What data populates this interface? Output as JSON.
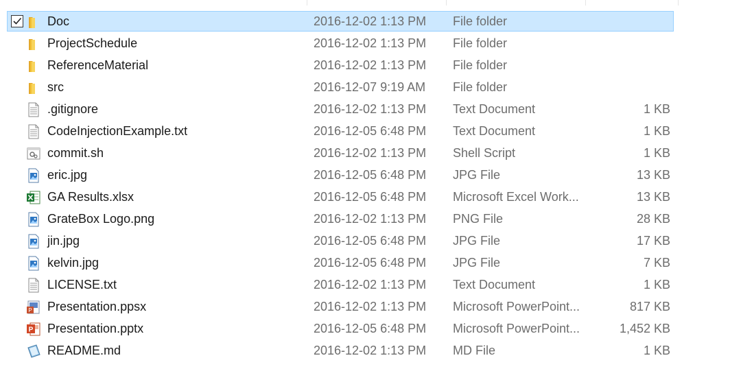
{
  "colors": {
    "selection_bg": "#cce8ff",
    "selection_border": "#99d1ff",
    "folder": "#f6c94e",
    "secondary_text": "#6d6d6d"
  },
  "files": [
    {
      "name": "Doc",
      "date": "2016-12-02 1:13 PM",
      "type": "File folder",
      "size": "",
      "icon": "folder-icon",
      "selected": true
    },
    {
      "name": "ProjectSchedule",
      "date": "2016-12-02 1:13 PM",
      "type": "File folder",
      "size": "",
      "icon": "folder-icon"
    },
    {
      "name": "ReferenceMaterial",
      "date": "2016-12-02 1:13 PM",
      "type": "File folder",
      "size": "",
      "icon": "folder-icon"
    },
    {
      "name": "src",
      "date": "2016-12-07 9:19 AM",
      "type": "File folder",
      "size": "",
      "icon": "folder-icon"
    },
    {
      "name": ".gitignore",
      "date": "2016-12-02 1:13 PM",
      "type": "Text Document",
      "size": "1 KB",
      "icon": "text-file-icon"
    },
    {
      "name": "CodeInjectionExample.txt",
      "date": "2016-12-05 6:48 PM",
      "type": "Text Document",
      "size": "1 KB",
      "icon": "text-file-icon"
    },
    {
      "name": "commit.sh",
      "date": "2016-12-02 1:13 PM",
      "type": "Shell Script",
      "size": "1 KB",
      "icon": "shell-script-icon"
    },
    {
      "name": "eric.jpg",
      "date": "2016-12-05 6:48 PM",
      "type": "JPG File",
      "size": "13 KB",
      "icon": "image-file-icon"
    },
    {
      "name": "GA Results.xlsx",
      "date": "2016-12-05 6:48 PM",
      "type": "Microsoft Excel Work...",
      "size": "13 KB",
      "icon": "excel-file-icon"
    },
    {
      "name": "GrateBox Logo.png",
      "date": "2016-12-02 1:13 PM",
      "type": "PNG File",
      "size": "28 KB",
      "icon": "image-file-icon"
    },
    {
      "name": "jin.jpg",
      "date": "2016-12-05 6:48 PM",
      "type": "JPG File",
      "size": "17 KB",
      "icon": "image-file-icon"
    },
    {
      "name": "kelvin.jpg",
      "date": "2016-12-05 6:48 PM",
      "type": "JPG File",
      "size": "7 KB",
      "icon": "image-file-icon"
    },
    {
      "name": "LICENSE.txt",
      "date": "2016-12-02 1:13 PM",
      "type": "Text Document",
      "size": "1 KB",
      "icon": "text-file-icon"
    },
    {
      "name": "Presentation.ppsx",
      "date": "2016-12-02 1:13 PM",
      "type": "Microsoft PowerPoint...",
      "size": "817 KB",
      "icon": "powerpoint-show-icon"
    },
    {
      "name": "Presentation.pptx",
      "date": "2016-12-05 6:48 PM",
      "type": "Microsoft PowerPoint...",
      "size": "1,452 KB",
      "icon": "powerpoint-file-icon"
    },
    {
      "name": "README.md",
      "date": "2016-12-02 1:13 PM",
      "type": "MD File",
      "size": "1 KB",
      "icon": "md-file-icon"
    }
  ]
}
